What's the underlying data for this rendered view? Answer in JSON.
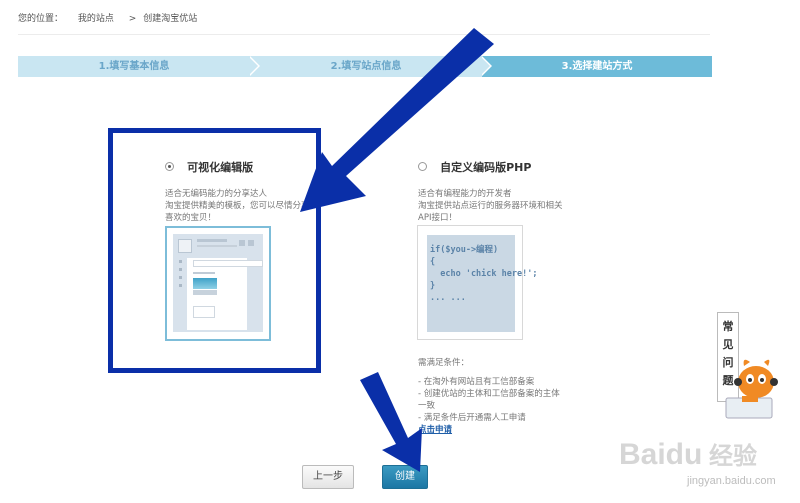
{
  "breadcrumb": {
    "label": "您的位置：",
    "item1": "我的站点",
    "separator": ">",
    "item2": "创建淘宝优站"
  },
  "steps": [
    {
      "label": "1.填写基本信息",
      "active": false
    },
    {
      "label": "2.填写站点信息",
      "active": false
    },
    {
      "label": "3.选择建站方式",
      "active": true
    }
  ],
  "options": {
    "visual": {
      "title": "可视化编辑版",
      "selected": true,
      "desc_lines": [
        "适合无编码能力的分享达人",
        "淘宝提供精美的模板，您可以尽情分享",
        "喜欢的宝贝！"
      ]
    },
    "custom": {
      "title": "自定义编码版PHP",
      "selected": false,
      "desc_lines": [
        "适合有编程能力的开发者",
        "淘宝提供站点运行的服务器环境和相关",
        "API接口！"
      ],
      "code_preview": "if($you->编程)\n{\n  echo 'chick here!';\n}\n... ..."
    }
  },
  "requirements": {
    "title": "需满足条件：",
    "lines": [
      "- 在淘外有网站且有工信部备案",
      "- 创建优站的主体和工信部备案的主体",
      "一致",
      "- 满足条件后开通需人工申请"
    ],
    "apply_link": "点击申请"
  },
  "buttons": {
    "prev": "上一步",
    "create": "创建"
  },
  "faq": {
    "chars": [
      "常",
      "见",
      "问",
      "题"
    ]
  },
  "watermark": {
    "brand": "Baidu",
    "brand_cn": "经验",
    "url": "jingyan.baidu.com"
  },
  "colors": {
    "step_inactive": "#c9e6f2",
    "step_active": "#6dbbd9",
    "annotation_blue": "#0a2fa8",
    "create_button": "#1f7aa6"
  }
}
